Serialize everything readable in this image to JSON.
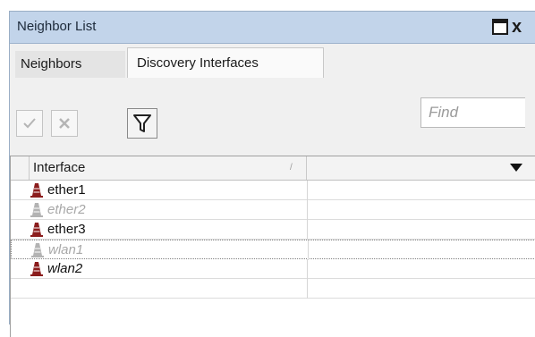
{
  "window": {
    "title": "Neighbor List",
    "restore_icon": "restore-window-icon",
    "close_icon": "close-icon",
    "close_glyph": "x"
  },
  "tabs": [
    {
      "label": "Neighbors",
      "active": false
    },
    {
      "label": "Discovery Interfaces",
      "active": true
    }
  ],
  "toolbar": {
    "enable_icon": "check-icon",
    "disable_icon": "cross-icon",
    "filter_icon": "filter-icon",
    "find_placeholder": "Find"
  },
  "table": {
    "columns": [
      "Interface",
      ""
    ],
    "sort_indicator": "/",
    "rows": [
      {
        "name": "ether1",
        "status": "enabled",
        "icon": "interface-icon"
      },
      {
        "name": "ether2",
        "status": "disabled",
        "icon": "interface-icon"
      },
      {
        "name": "ether3",
        "status": "enabled",
        "icon": "interface-icon"
      },
      {
        "name": "wlan1",
        "status": "disabled",
        "icon": "interface-icon"
      },
      {
        "name": "wlan2",
        "status": "enabled",
        "icon": "interface-icon"
      }
    ]
  },
  "colors": {
    "titlebar": "#c2d4ea",
    "icon_enabled": "#8b1d1d",
    "icon_disabled": "#b3b3b3"
  }
}
